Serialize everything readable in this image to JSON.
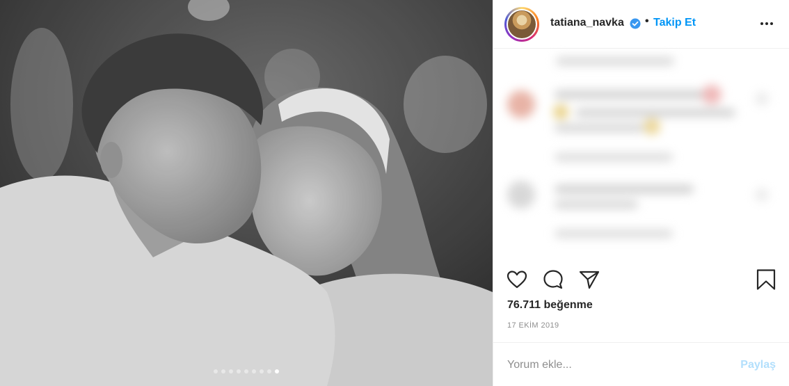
{
  "post": {
    "username": "tatiana_navka",
    "separator": "•",
    "follow_label": "Takip Et",
    "likes_text": "76.711 beğenme",
    "date_text": "17 EKİM 2019"
  },
  "media": {
    "carousel_count": 9,
    "carousel_active_index": 8
  },
  "comment": {
    "placeholder": "Yorum ekle...",
    "post_label": "Paylaş"
  },
  "icons": {
    "verified": "verified-badge-icon",
    "more": "more-options-icon",
    "like": "heart-icon",
    "comment": "comment-bubble-icon",
    "share": "paper-plane-icon",
    "save": "bookmark-icon"
  },
  "colors": {
    "accent": "#0095f6",
    "post_disabled": "#b2dffc",
    "text": "#262626",
    "muted": "#8e8e8e"
  }
}
